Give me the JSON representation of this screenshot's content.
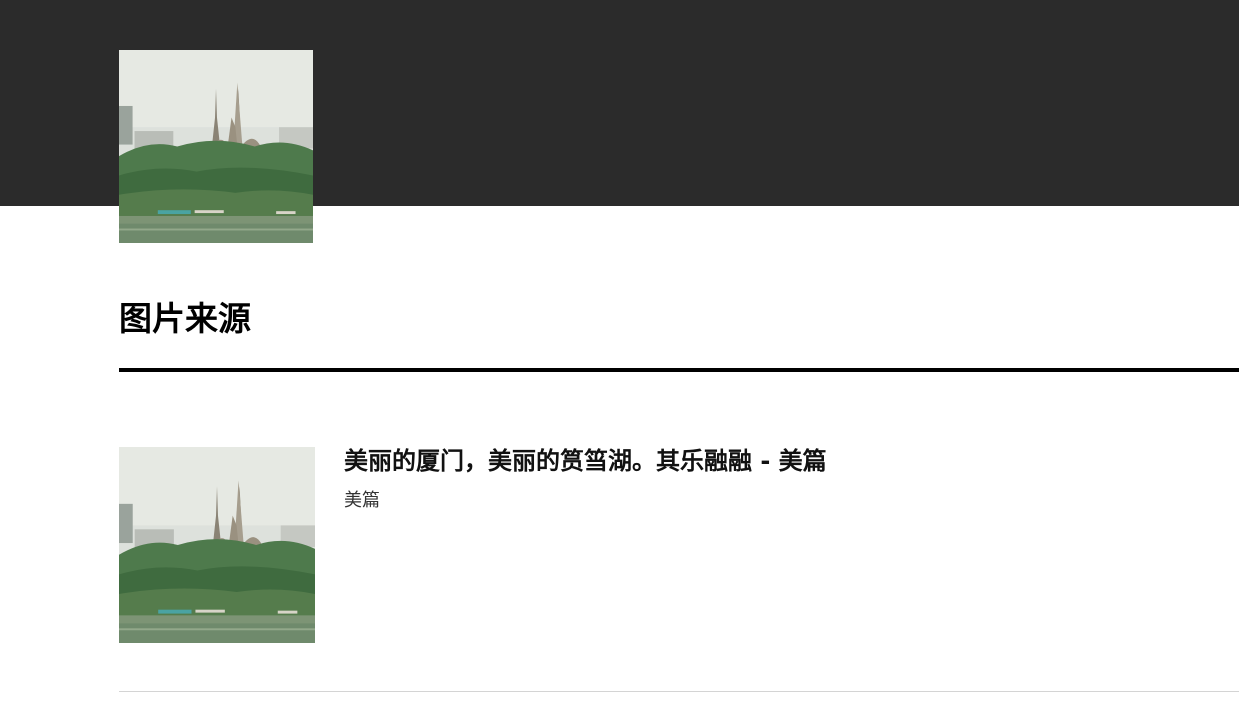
{
  "section": {
    "title": "图片来源"
  },
  "results": [
    {
      "title": "美丽的厦门，美丽的筼筜湖。其乐融融 - 美篇",
      "source": "美篇"
    }
  ]
}
